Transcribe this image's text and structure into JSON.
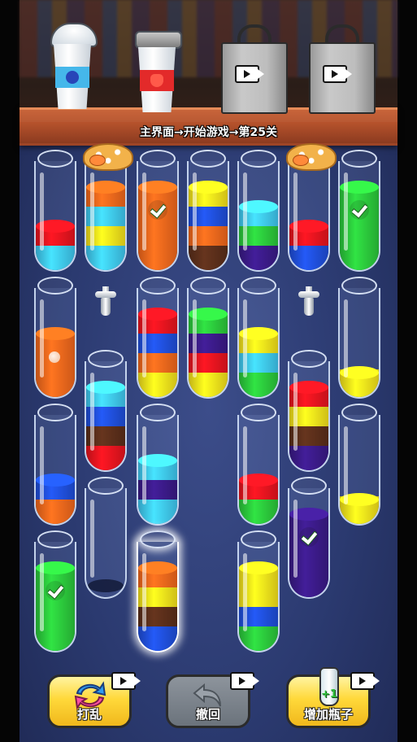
{
  "level_text": "主界面→开始游戏→第25关",
  "buttons": {
    "shuffle_label": "打乱",
    "undo_label": "撤回",
    "add_bottle_label": "增加瓶子",
    "add_bottle_badge": "+1"
  },
  "colors": {
    "red": "#e6141e",
    "lightblue": "#3ec6ef",
    "orange": "#f0661c",
    "yellow": "#f3df1b",
    "blue": "#1f4ed8",
    "brown": "#5a2e1a",
    "green": "#2bc63b",
    "purple": "#3a1a86",
    "darkgreen": "#1a8f2a"
  },
  "tubes": [
    {
      "id": "r1c1",
      "layers": [
        "lightblue",
        "red"
      ]
    },
    {
      "id": "r1c2",
      "jar": true,
      "tap": true,
      "layers": [
        "lightblue",
        "yellow",
        "lightblue",
        "orange"
      ]
    },
    {
      "id": "r1c3",
      "complete": true,
      "layers": [
        "orange",
        "orange",
        "orange",
        "orange"
      ]
    },
    {
      "id": "r1c4",
      "layers": [
        "brown",
        "orange",
        "blue",
        "yellow"
      ]
    },
    {
      "id": "r1c5",
      "layers": [
        "purple",
        "green",
        "lightblue"
      ]
    },
    {
      "id": "r1c6",
      "jar": true,
      "tap": true,
      "layers": [
        "blue",
        "red"
      ]
    },
    {
      "id": "r1c7",
      "complete": true,
      "layers": [
        "green",
        "green",
        "green",
        "green"
      ]
    },
    {
      "id": "r2c1",
      "bubble": true,
      "layers": [
        "orange",
        "orange",
        "orange"
      ]
    },
    {
      "id": "r2c3",
      "layers": [
        "yellow",
        "orange",
        "blue",
        "red"
      ]
    },
    {
      "id": "r2c4",
      "layers": [
        "yellow",
        "red",
        "purple",
        "green"
      ]
    },
    {
      "id": "r2c5",
      "layers": [
        "green",
        "lightblue",
        "yellow"
      ]
    },
    {
      "id": "r2c7",
      "layers": [
        "yellow"
      ]
    },
    {
      "id": "r3c2",
      "layers": [
        "red",
        "brown",
        "blue",
        "lightblue"
      ]
    },
    {
      "id": "r3c6",
      "layers": [
        "purple",
        "brown",
        "yellow",
        "red"
      ]
    },
    {
      "id": "r4c1",
      "layers": [
        "orange",
        "blue"
      ]
    },
    {
      "id": "r4c3",
      "layers": [
        "lightblue",
        "purple",
        "lightblue"
      ]
    },
    {
      "id": "r4c5",
      "layers": [
        "green",
        "red"
      ]
    },
    {
      "id": "r4c7",
      "layers": [
        "yellow"
      ]
    },
    {
      "id": "r5c2",
      "layers": []
    },
    {
      "id": "r5c6",
      "complete": true,
      "layers": [
        "purple",
        "purple",
        "purple",
        "purple"
      ]
    },
    {
      "id": "r6c1",
      "complete": true,
      "layers": [
        "green",
        "green",
        "green",
        "green"
      ]
    },
    {
      "id": "r6c3",
      "selected": true,
      "layers": [
        "blue",
        "brown",
        "yellow",
        "orange"
      ]
    },
    {
      "id": "r6c5",
      "layers": [
        "green",
        "blue",
        "yellow",
        "yellow"
      ]
    }
  ]
}
